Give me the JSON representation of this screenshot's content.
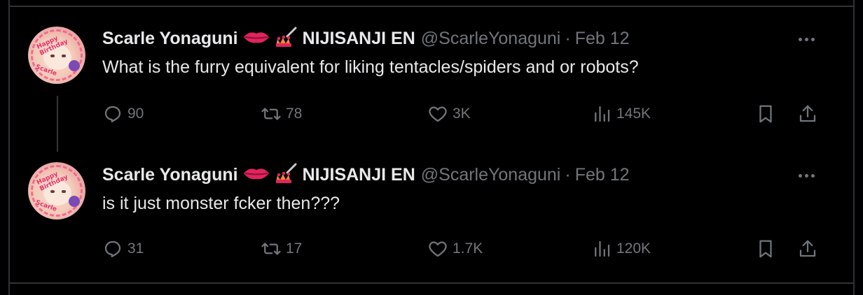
{
  "tweets": [
    {
      "display_name": "Scarle Yonaguni",
      "org": "NIJISANJI EN",
      "handle": "@ScarleYonaguni",
      "separator": "·",
      "date": "Feb 12",
      "text": "What is the furry equivalent for liking tentacles/spiders and or robots?",
      "replies": "90",
      "reposts": "78",
      "likes": "3K",
      "views": "145K",
      "avatar_text_top": "Happy Birthday",
      "avatar_text_bottom": "Scarle"
    },
    {
      "display_name": "Scarle Yonaguni",
      "org": "NIJISANJI EN",
      "handle": "@ScarleYonaguni",
      "separator": "·",
      "date": "Feb 12",
      "text": "is it just monster fcker then???",
      "replies": "31",
      "reposts": "17",
      "likes": "1.7K",
      "views": "120K",
      "avatar_text_top": "Happy Birthday",
      "avatar_text_bottom": "Scarle"
    }
  ],
  "icons": {
    "lips": "lips-icon",
    "nail_polish": "nail-polish-icon",
    "reply": "reply-icon",
    "repost": "repost-icon",
    "like": "heart-icon",
    "views": "views-icon",
    "bookmark": "bookmark-icon",
    "share": "share-icon",
    "more": "more-icon"
  },
  "colors": {
    "background": "#000000",
    "text_primary": "#e7e9ea",
    "text_secondary": "#71767b",
    "border": "#2f3336",
    "lips": "#e0245e"
  }
}
